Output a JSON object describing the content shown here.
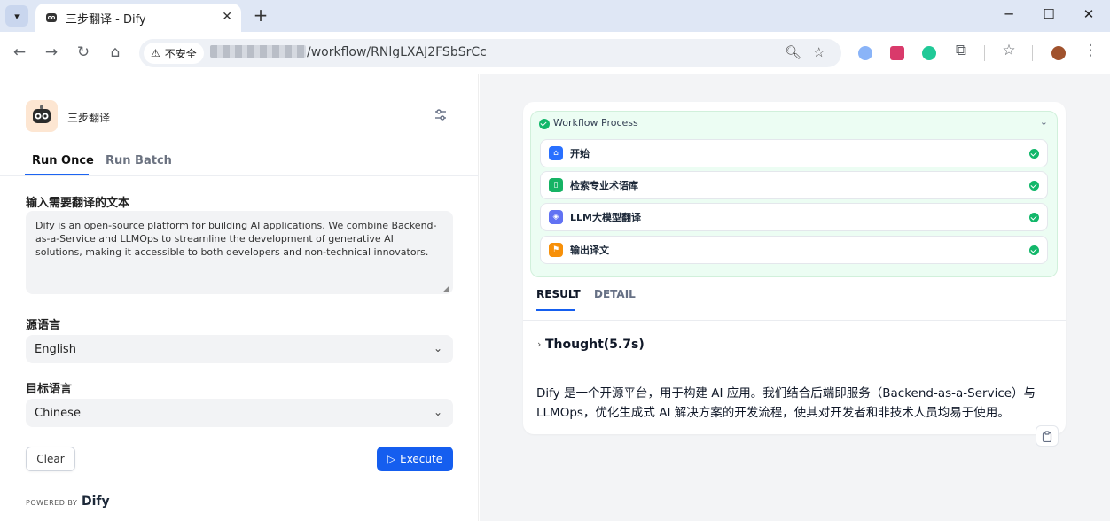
{
  "browser": {
    "tab_title": "三步翻译 - Dify",
    "insecure_label": "不安全",
    "url_path": "/workflow/RNlgLXAJ2FSbSrCc"
  },
  "app": {
    "name": "三步翻译",
    "tabs": [
      "Run Once",
      "Run Batch"
    ],
    "fields": {
      "text_label": "输入需要翻译的文本",
      "text_value": "Dify is an open-source platform for building AI applications. We combine Backend-as-a-Service and LLMOps to streamline the development of generative AI solutions, making it accessible to both developers and non-technical innovators.",
      "source_label": "源语言",
      "source_value": "English",
      "target_label": "目标语言",
      "target_value": "Chinese"
    },
    "clear_label": "Clear",
    "execute_label": "Execute",
    "powered_by": "POWERED BY",
    "brand": "Dify"
  },
  "workflow": {
    "title": "Workflow Process",
    "nodes": [
      {
        "label": "开始",
        "color": "#2970ff"
      },
      {
        "label": "检索专业术语库",
        "color": "#16b364"
      },
      {
        "label": "LLM大模型翻译",
        "color": "#6172f3"
      },
      {
        "label": "输出译文",
        "color": "#f79009"
      }
    ]
  },
  "result": {
    "tabs": [
      "RESULT",
      "DETAIL"
    ],
    "thought": "Thought(5.7s)",
    "text": "Dify 是一个开源平台，用于构建 AI 应用。我们结合后端即服务（Backend-as-a-Service）与 LLMOps，优化生成式 AI 解决方案的开发流程，使其对开发者和非技术人员均易于使用。"
  }
}
